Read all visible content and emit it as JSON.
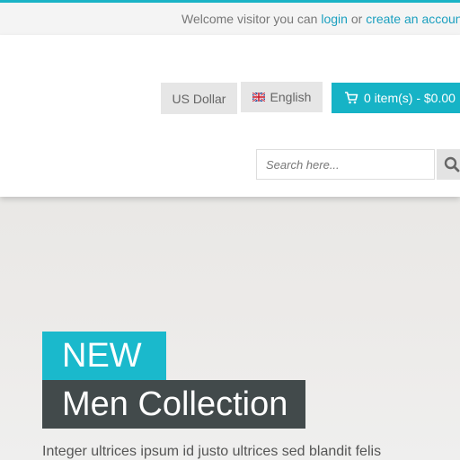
{
  "topbar": {
    "welcome_text": "Welcome visitor you can",
    "login_label": "login",
    "or_text": "or",
    "create_account_label": "create an account"
  },
  "header": {
    "currency_label": "US Dollar",
    "language_label": "English",
    "cart_label": "0 item(s) - $0.00"
  },
  "search": {
    "placeholder": "Search here..."
  },
  "hero": {
    "badge": "NEW",
    "title": "Men Collection",
    "text": "Integer ultrices ipsum id justo ultrices sed blandit felis"
  },
  "colors": {
    "accent": "#1ab3c6",
    "dark": "#424a4b"
  },
  "icons": [
    "cart-icon",
    "search-icon",
    "uk-flag-icon"
  ]
}
